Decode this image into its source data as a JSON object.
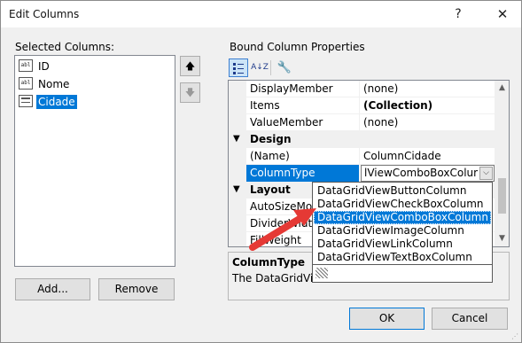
{
  "window": {
    "title": "Edit Columns",
    "help": "?",
    "close": "✕"
  },
  "left": {
    "label": "Selected Columns:",
    "columns": [
      {
        "name": "ID",
        "icon": "textbox-column-icon"
      },
      {
        "name": "Nome",
        "icon": "textbox-column-icon"
      },
      {
        "name": "Cidade",
        "icon": "combobox-column-icon",
        "selected": true
      }
    ],
    "move_up": "🡅",
    "move_down": "🡇",
    "add_label": "Add...",
    "remove_label": "Remove"
  },
  "right": {
    "label": "Bound Column Properties",
    "toolbar": {
      "categorized": "categorized-icon",
      "alphabetical_text": "A↓Z",
      "wrench": "🔧"
    },
    "rows": [
      {
        "name": "DisplayMember",
        "value": "(none)"
      },
      {
        "name": "Items",
        "value": "(Collection)",
        "bold": true
      },
      {
        "name": "ValueMember",
        "value": "(none)"
      }
    ],
    "design_category": "Design",
    "design_rows": [
      {
        "name": "(Name)",
        "value": "ColumnCidade"
      },
      {
        "name": "ColumnType",
        "value": "lViewComboBoxColumn"
      }
    ],
    "layout_category": "Layout",
    "layout_rows": [
      {
        "name": "AutoSizeMode"
      },
      {
        "name": "DividerWidth"
      },
      {
        "name": "FillWeight"
      }
    ],
    "description": {
      "title": "ColumnType",
      "text": "The DataGridView"
    }
  },
  "dropdown": {
    "options": [
      "DataGridViewButtonColumn",
      "DataGridViewCheckBoxColumn",
      "DataGridViewComboBoxColumn",
      "DataGridViewImageColumn",
      "DataGridViewLinkColumn",
      "DataGridViewTextBoxColumn"
    ],
    "selected_index": 2
  },
  "buttons": {
    "ok": "OK",
    "cancel": "Cancel"
  },
  "colors": {
    "selection": "#0078d7",
    "annotation_arrow": "#e53935"
  }
}
